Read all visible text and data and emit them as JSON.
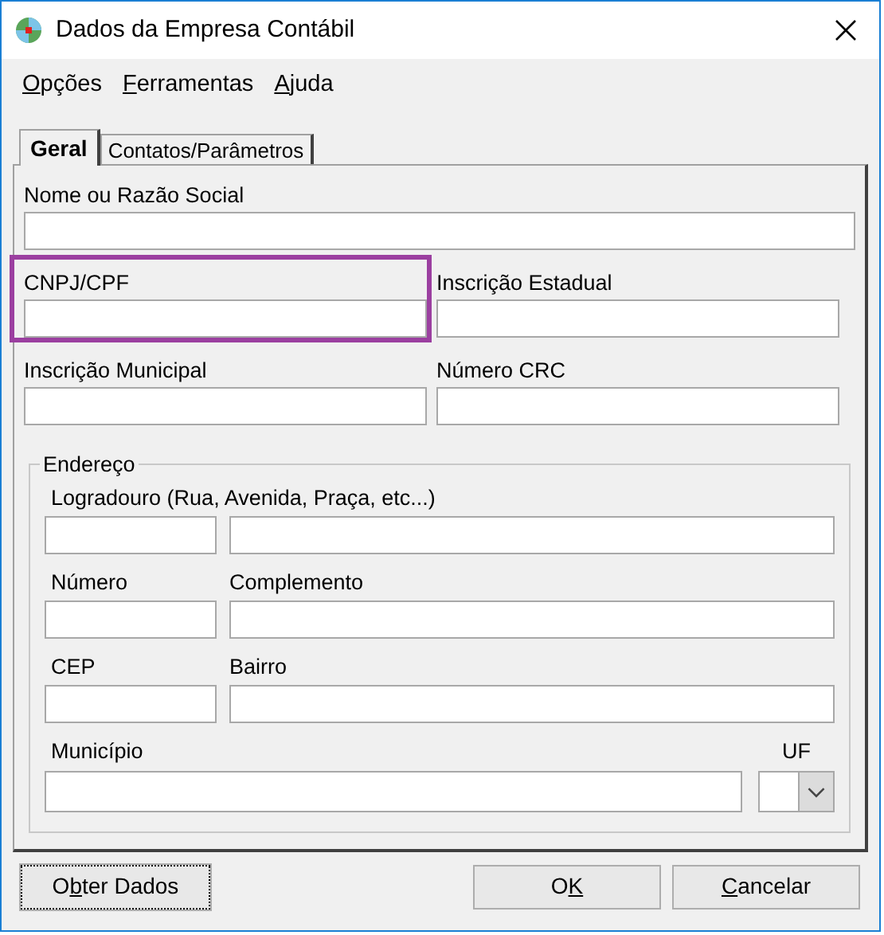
{
  "window": {
    "title": "Dados da Empresa Contábil"
  },
  "menu": [
    {
      "key": "O",
      "post": "pções"
    },
    {
      "key": "F",
      "post": "erramentas"
    },
    {
      "key": "A",
      "post": "juda"
    }
  ],
  "tabs": [
    {
      "label": "Geral",
      "selected": true
    },
    {
      "label": "Contatos/Parâmetros",
      "selected": false
    }
  ],
  "rows": [
    [
      {
        "label": "Nome ou Razão Social",
        "highlighted": false
      }
    ],
    [
      {
        "label": "CNPJ/CPF",
        "highlighted": true
      },
      {
        "label": "Inscrição Estadual",
        "highlighted": false
      }
    ],
    [
      {
        "label": "Inscrição Municipal",
        "highlighted": false
      },
      {
        "label": "Número CRC",
        "highlighted": false
      }
    ]
  ],
  "address": {
    "title": "Endereço",
    "rows": [
      {
        "labels": [
          "Logradouro (Rua, Avenida, Praça, etc...)"
        ]
      },
      {
        "labels": [
          "Número",
          "Complemento"
        ]
      },
      {
        "labels": [
          "CEP",
          "Bairro"
        ]
      }
    ],
    "city": {
      "label": "Município"
    },
    "state": {
      "label": "UF"
    }
  },
  "buttons": [
    {
      "pre": "O",
      "key": "b",
      "post": "ter Dados",
      "focused": true
    },
    {
      "pre": "O",
      "key": "K",
      "focused": false
    },
    {
      "key": "C",
      "post": "ancelar",
      "focused": false
    }
  ]
}
